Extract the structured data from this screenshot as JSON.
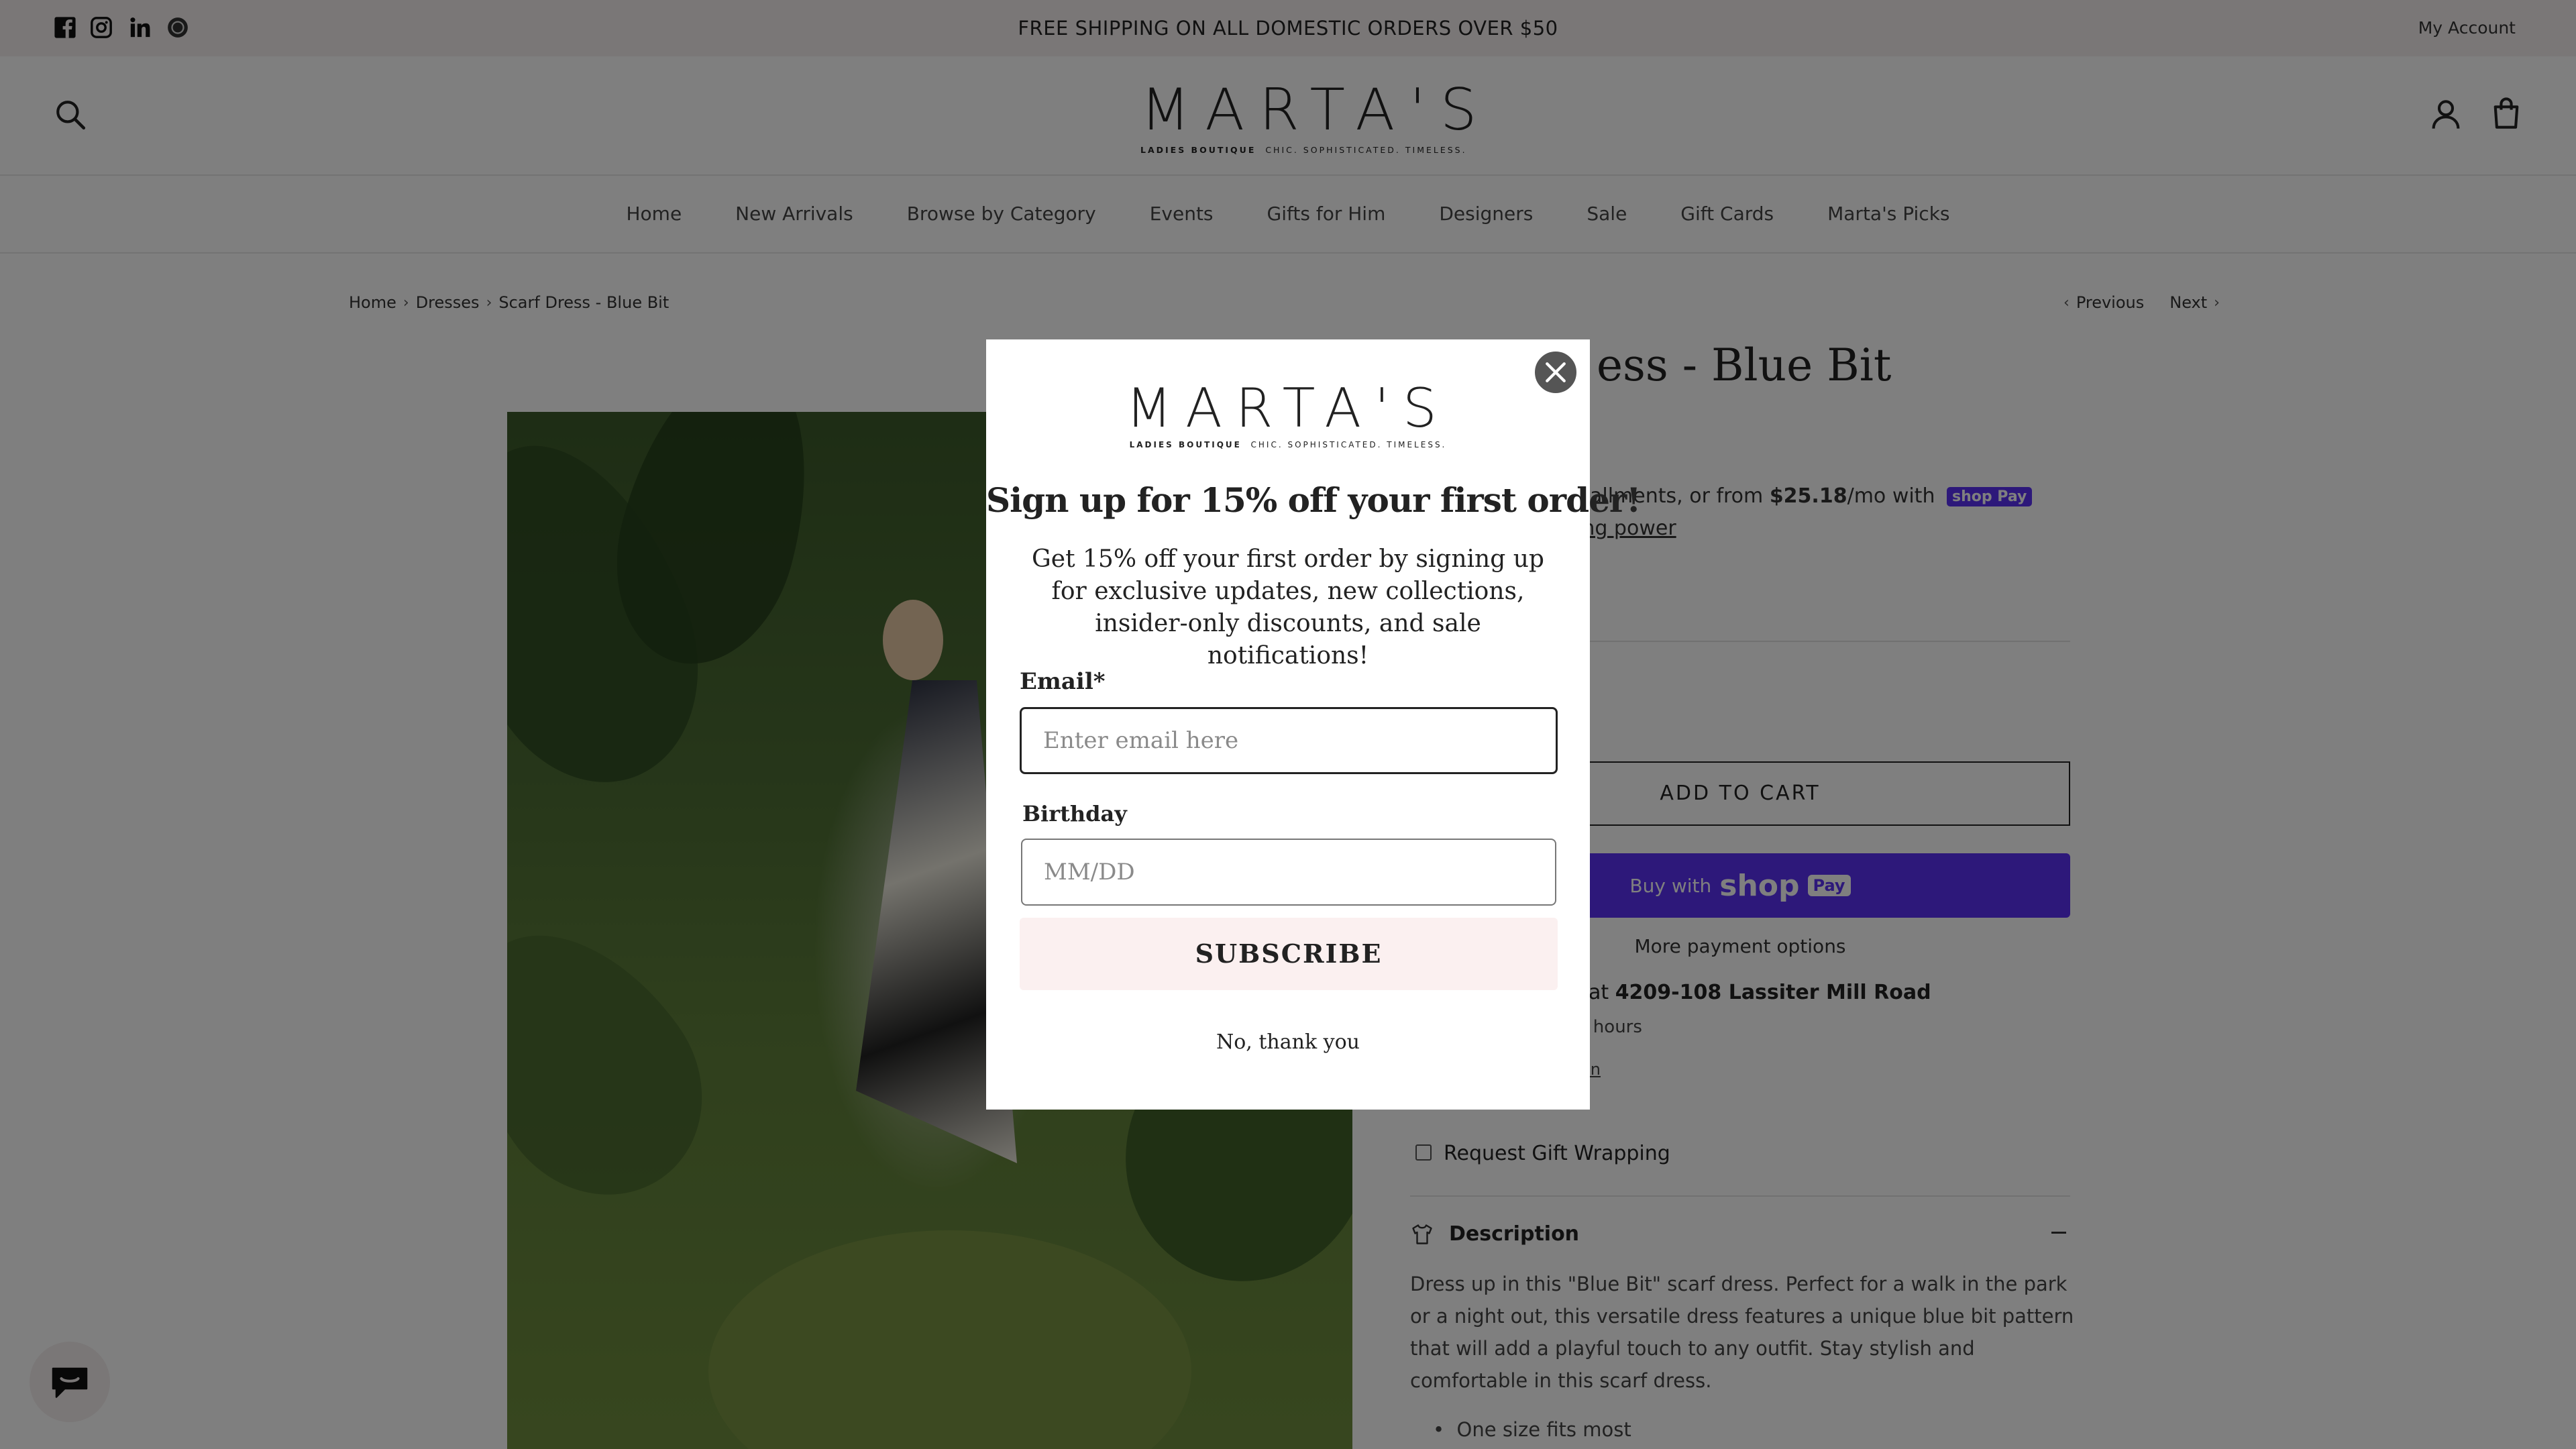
{
  "announcement": {
    "text": "FREE SHIPPING ON ALL DOMESTIC ORDERS OVER $50",
    "account_link": "My Account",
    "social_icons": [
      "facebook-icon",
      "instagram-icon",
      "linkedin-icon",
      "other-social-icon"
    ]
  },
  "header": {
    "logo_word": "MARTA'S",
    "logo_tag_bold": "LADIES BOUTIQUE",
    "logo_tag": "CHIC. SOPHISTICATED. TIMELESS."
  },
  "nav": {
    "items": [
      "Home",
      "New Arrivals",
      "Browse by Category",
      "Events",
      "Gifts for Him",
      "Designers",
      "Sale",
      "Gift Cards",
      "Marta's Picks"
    ]
  },
  "breadcrumb": {
    "items": [
      "Home",
      "Dresses",
      "Scarf Dress - Blue Bit"
    ],
    "previous": "Previous",
    "next": "Next"
  },
  "product": {
    "title_visible": "ess - Blue Bit",
    "installments_prefix": "allments, or from",
    "installment_amount": "$25.18",
    "installments_suffix": "/mo with",
    "shop_pay_badge": "shop Pay",
    "buying_power_link": "ing power",
    "add_to_cart": "ADD TO CART",
    "buy_with": "Buy with",
    "shop_word": "shop",
    "pay_word": "Pay",
    "more_payment": "More payment options",
    "pickup_prefix": "e at",
    "pickup_address": "4209-108 Lassiter Mill Road",
    "pickup_time": "4 hours",
    "pickup_info_link": "tion",
    "gift_wrap_label": "Request Gift Wrapping",
    "description_heading": "Description",
    "description_text": "Dress up in this \"Blue Bit\" scarf dress. Perfect for a walk in the park or a night out, this versatile dress features a unique blue bit pattern that will add a playful touch to any outfit. Stay stylish and comfortable in this scarf dress.",
    "bullet_1": "One size fits most"
  },
  "modal": {
    "logo_word": "MARTA'S",
    "logo_tag_bold": "LADIES BOUTIQUE",
    "logo_tag": "CHIC. SOPHISTICATED. TIMELESS.",
    "heading": "Sign up for 15% off your first order!",
    "body": "Get 15% off your first order by signing up for exclusive updates, new collections, insider-only discounts, and sale notifications!",
    "email_label": "Email*",
    "email_placeholder": "Enter email here",
    "birthday_label": "Birthday",
    "birthday_placeholder": "MM/DD",
    "subscribe_label": "SUBSCRIBE",
    "decline_label": "No, thank you"
  },
  "colors": {
    "announcement_bg": "#f4eeee",
    "shop_pay_purple": "#5a31f4",
    "subscribe_bg": "#fbf0f0",
    "overlay": "rgba(0,0,0,0.5)"
  }
}
